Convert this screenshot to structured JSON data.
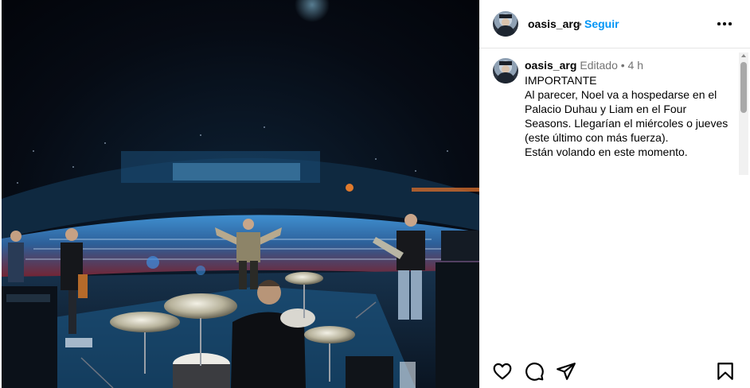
{
  "post": {
    "username": "oasis_arg",
    "header_dot": "•",
    "follow_label": "Seguir",
    "more_icon": "more-horizontal-icon"
  },
  "caption": {
    "username": "oasis_arg",
    "meta": "Editado •  4 h",
    "text": "IMPORTANTE\nAl parecer, Noel va a hospedarse en el Palacio Duhau y Liam en el Four Seasons. Llegarían el miércoles o jueves (este último con más fuerza).\nEstán volando en este momento."
  },
  "actions": {
    "icons": [
      "heart-icon",
      "comment-icon",
      "share-icon",
      "bookmark-icon"
    ]
  },
  "colors": {
    "follow_blue": "#0095f6",
    "meta_gray": "#737373",
    "divider": "#e5e5e5"
  }
}
